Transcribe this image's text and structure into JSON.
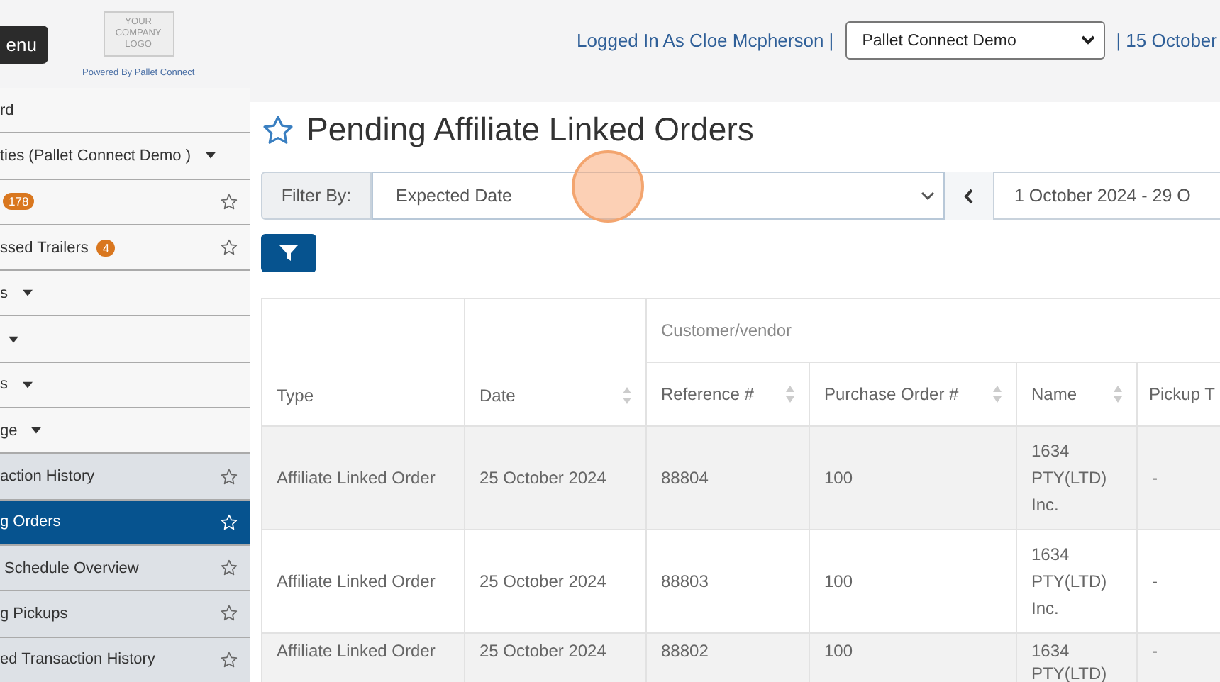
{
  "header": {
    "menu_button": "enu",
    "logo": {
      "lines": [
        "YOUR",
        "COMPANY",
        "LOGO"
      ],
      "caption": "Powered By Pallet Connect"
    },
    "logged_in": "Logged In As Cloe Mcpherson |",
    "company_select": "Pallet Connect Demo",
    "date": "| 15 October"
  },
  "sidebar": {
    "items": [
      {
        "kind": "plain",
        "label": "rd",
        "selected": false
      },
      {
        "kind": "dropdown",
        "label": "ties (Pallet Connect Demo )",
        "selected": false
      },
      {
        "kind": "link",
        "badge": "178",
        "selected": false
      },
      {
        "kind": "link",
        "label": "ssed Trailers",
        "badge": "4",
        "selected": false
      },
      {
        "kind": "dropdown",
        "label": "s",
        "selected": false
      },
      {
        "kind": "dropdown",
        "selected": false
      },
      {
        "kind": "dropdown",
        "label": "s",
        "selected": false
      },
      {
        "kind": "dropdown",
        "label": "ge",
        "selected": false
      },
      {
        "kind": "sublink",
        "label": "action History",
        "selected": false
      },
      {
        "kind": "sublink",
        "label": "g Orders",
        "selected": true
      },
      {
        "kind": "sublink",
        "label": " Schedule Overview",
        "selected": false
      },
      {
        "kind": "sublink",
        "label": "g Pickups",
        "selected": false
      },
      {
        "kind": "sublink",
        "label": "ed Transaction History",
        "selected": false
      }
    ]
  },
  "page": {
    "title": "Pending Affiliate Linked Orders",
    "filter": {
      "label": "Filter By:",
      "value": "Expected Date",
      "date_range": "1 October 2024 - 29 O"
    },
    "table": {
      "group_header": "Customer/vendor",
      "columns": [
        {
          "label": "Type",
          "sortable": false
        },
        {
          "label": "Date",
          "sortable": true
        },
        {
          "label": "Reference #",
          "sortable": true
        },
        {
          "label": "Purchase Order #",
          "sortable": true
        },
        {
          "label": "Name",
          "sortable": true
        },
        {
          "label": "Pickup T"
        }
      ],
      "rows": [
        [
          "Affiliate Linked Order",
          "25 October 2024",
          "88804",
          "100",
          "1634 PTY(LTD) Inc.",
          "-"
        ],
        [
          "Affiliate Linked Order",
          "25 October 2024",
          "88803",
          "100",
          "1634 PTY(LTD) Inc.",
          "-"
        ],
        [
          "Affiliate Linked Order",
          "25 October 2024",
          "88802",
          "100",
          "1634 PTY(LTD)",
          "-"
        ]
      ]
    }
  }
}
